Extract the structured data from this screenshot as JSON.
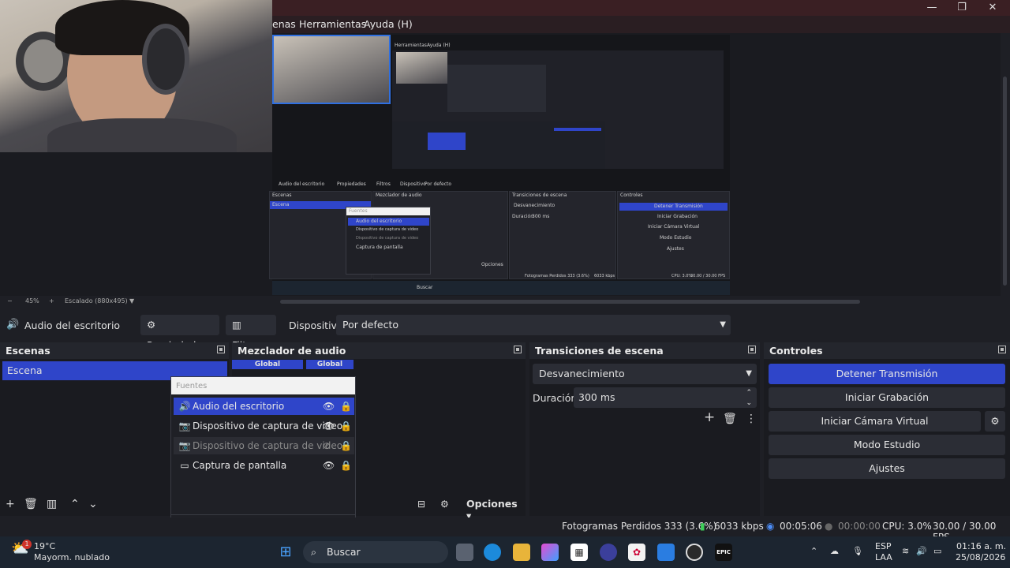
{
  "menu": {
    "items": [
      "enas",
      "Herramientas",
      "Ayuda (H)"
    ]
  },
  "window_controls": {
    "minimize": "—",
    "maximize": "❐",
    "close": "✕"
  },
  "preview": {
    "zoom": "45%",
    "scaling_label": "Escalado (880x495)",
    "zoom_minus": "−",
    "zoom_plus": "+"
  },
  "context_bar": {
    "source_name": "Audio del escritorio",
    "properties_label": "Propiedades",
    "filters_label": "Filtros",
    "device_label": "Dispositivo",
    "device_value": "Por defecto"
  },
  "scenes": {
    "title": "Escenas",
    "items": [
      "Escena"
    ]
  },
  "audio_mixer": {
    "title": "Mezclador de audio",
    "channel_labels": [
      "Global",
      "Global"
    ],
    "options_label": "Opciones"
  },
  "sources": {
    "title": "Fuentes",
    "items": [
      {
        "label": "Audio del escritorio",
        "icon": "speaker-icon"
      },
      {
        "label": "Dispositivo de captura de video",
        "icon": "camera-icon"
      },
      {
        "label": "Dispositivo de captura de video",
        "icon": "camera-icon"
      },
      {
        "label": "Captura de pantalla",
        "icon": "monitor-icon"
      }
    ]
  },
  "transitions": {
    "title": "Transiciones de escena",
    "type_value": "Desvanecimiento",
    "duration_label": "Duración",
    "duration_value": "300 ms"
  },
  "controls": {
    "title": "Controles",
    "stop_stream": "Detener Transmisión",
    "start_recording": "Iniciar Grabación",
    "start_virtual_cam": "Iniciar Cámara Virtual",
    "studio_mode": "Modo Estudio",
    "settings": "Ajustes"
  },
  "status_bar": {
    "dropped_frames": "Fotogramas Perdidos 333 (3.6%)",
    "bitrate": "6033 kbps",
    "stream_time": "00:05:06",
    "record_time": "00:00:00",
    "cpu": "CPU: 3.0%",
    "fps": "30.00 / 30.00 FPS"
  },
  "taskbar": {
    "weather_temp": "19°C",
    "weather_desc": "Mayorm. nublado",
    "weather_badge": "1",
    "search_label": "Buscar",
    "lang_top": "ESP",
    "lang_bottom": "LAA",
    "time": "01:16 a. m.",
    "date": "25/08/2026",
    "epic_label": "EPIC"
  },
  "nested_preview": {
    "menu_items": [
      "enas",
      "Herramientas",
      "Ayuda (H)"
    ],
    "source_name": "Audio del escritorio",
    "properties": "Propiedades",
    "filters": "Filtros",
    "device": "Dispositivo",
    "device_value": "Por defecto",
    "scenes": "Escenas",
    "scene_item": "Escena",
    "mixer": "Mezclador de audio",
    "transitions": "Transiciones de escena",
    "controls": "Controles",
    "fade": "Desvanecimiento",
    "duration": "Duración",
    "duration_value": "300 ms",
    "sources_title": "Fuentes",
    "src1": "Audio del escritorio",
    "src2": "Dispositivo de captura de video",
    "src3": "Dispositivo de captura de video",
    "src4": "Captura de pantalla",
    "stop": "Detener Transmisión",
    "rec": "Iniciar Grabación",
    "vcam": "Iniciar Cámara Virtual",
    "studio": "Modo Estudio",
    "settings": "Ajustes",
    "options": "Opciones",
    "status": "Fotogramas Perdidos 333 (3.6%)",
    "kbps": "6033 kbps",
    "cpu": "CPU: 3.0%",
    "fps": "30.00 / 30.00 FPS",
    "search": "Buscar",
    "zoom": "45%",
    "scaling": "Escalado (880x495)"
  },
  "colors": {
    "accent": "#2f45c9",
    "panel_bg": "#1a1b20",
    "header_bg": "#24262d",
    "titlebar": "#3a1f23"
  }
}
